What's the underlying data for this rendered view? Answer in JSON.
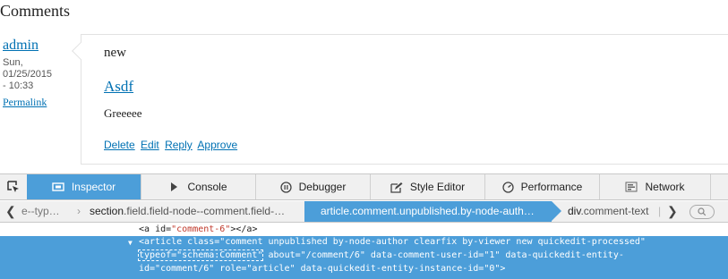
{
  "page": {
    "section_title": "Comments",
    "comment": {
      "author": "admin",
      "date_lines": [
        "Sun,",
        "01/25/2015",
        "- 10:33"
      ],
      "permalink": "Permalink",
      "new_marker": "new",
      "title": "Asdf",
      "body": "Greeeee",
      "links": [
        "Delete",
        "Edit",
        "Reply",
        "Approve"
      ]
    }
  },
  "devtools": {
    "tabs": [
      {
        "label": "Inspector",
        "icon": "inspector-icon",
        "selected": true
      },
      {
        "label": "Console",
        "icon": "console-icon",
        "selected": false
      },
      {
        "label": "Debugger",
        "icon": "debugger-icon",
        "selected": false
      },
      {
        "label": "Style Editor",
        "icon": "style-editor-icon",
        "selected": false
      },
      {
        "label": "Performance",
        "icon": "performance-icon",
        "selected": false
      },
      {
        "label": "Network",
        "icon": "network-icon",
        "selected": false
      }
    ],
    "breadcrumbs": {
      "truncated_left": "e--typ…",
      "item1_tag": "section",
      "item1_class": ".field.field-node--comment.field-…",
      "selected_tag": "article",
      "selected_class": ".comment.unpublished.by-node-auth…",
      "item3_tag": "div",
      "item3_class": ".comment-text"
    },
    "markup": {
      "line1_prefix": "<a ",
      "line1_attr": "id=",
      "line1_value": "\"comment-6\"",
      "line1_suffix": "></a>",
      "selected_line1": "<article class=\"comment unpublished by-node-author clearfix by-viewer new quickedit-processed\"",
      "selected_line2_boxed": "typeof=\"schema:Comment\"",
      "selected_line2_rest": " about=\"/comment/6\" data-comment-user-id=\"1\" data-quickedit-entity-",
      "selected_line3": "id=\"comment/6\" role=\"article\" data-quickedit-entity-instance-id=\"0\">"
    },
    "accent_color": "#4c9ed9"
  }
}
